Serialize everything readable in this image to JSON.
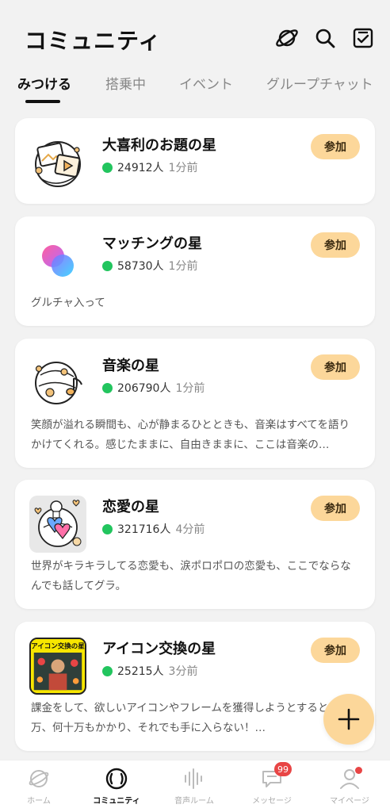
{
  "header": {
    "title": "コミュニティ",
    "icons": [
      "planet-icon",
      "search-icon",
      "checkbox-icon"
    ]
  },
  "tabs": [
    {
      "label": "みつける",
      "active": true
    },
    {
      "label": "搭乗中",
      "active": false
    },
    {
      "label": "イベント",
      "active": false
    },
    {
      "label": "グループチャット",
      "active": false
    }
  ],
  "cards": [
    {
      "title": "大喜利のお題の星",
      "count": "24912人",
      "time": "1分前",
      "join_label": "参加",
      "description": "",
      "thumb_icon": "photo-planet-icon"
    },
    {
      "title": "マッチングの星",
      "count": "58730人",
      "time": "1分前",
      "join_label": "参加",
      "description": "グルチャ入って",
      "thumb_icon": "matching-bubbles-icon"
    },
    {
      "title": "音楽の星",
      "count": "206790人",
      "time": "1分前",
      "join_label": "参加",
      "description": "笑顔が溢れる瞬間も、心が静まるひとときも、音楽はすべてを語りかけてくれる。感じたままに、自由きままに、ここは音楽の…",
      "thumb_icon": "music-planet-icon"
    },
    {
      "title": "恋愛の星",
      "count": "321716人",
      "time": "4分前",
      "join_label": "参加",
      "description": "世界がキラキラしてる恋愛も、涙ポロポロの恋愛も、ここでならなんでも話してグラ。",
      "thumb_icon": "love-planet-icon"
    },
    {
      "title": "アイコン交換の星",
      "count": "25215人",
      "time": "3分前",
      "join_label": "参加",
      "description": "課金をして、欲しいアイコンやフレームを獲得しようとすると、何万、何十万もかかり、それでも手に入らない！…",
      "thumb_icon": "icon-exchange-image",
      "thumb_text": "アイコン交換の星"
    }
  ],
  "fab": {
    "icon": "plus-icon"
  },
  "bottom_nav": [
    {
      "label": "ホーム",
      "icon": "home-planet-icon",
      "active": false
    },
    {
      "label": "コミュニティ",
      "icon": "community-icon",
      "active": true
    },
    {
      "label": "音声ルーム",
      "icon": "voice-wave-icon",
      "active": false
    },
    {
      "label": "メッセージ",
      "icon": "message-icon",
      "active": false,
      "badge": "99"
    },
    {
      "label": "マイページ",
      "icon": "profile-icon",
      "active": false
    }
  ],
  "colors": {
    "accent": "#fcd79a",
    "online": "#22c55e",
    "badge": "#e84545"
  }
}
